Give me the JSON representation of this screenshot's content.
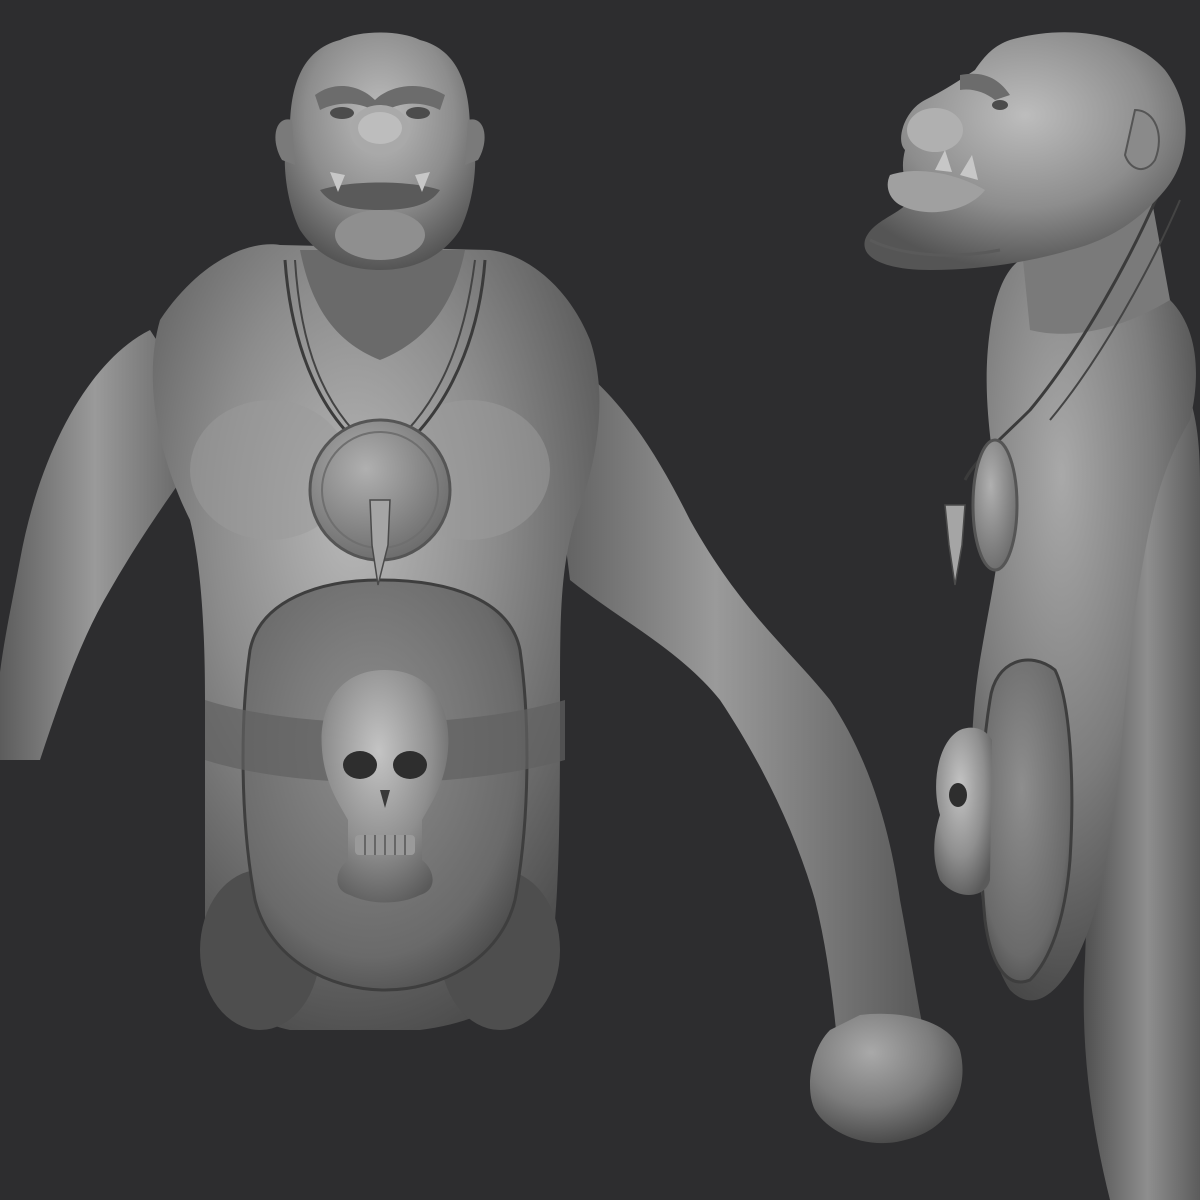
{
  "scene": {
    "background_color": "#2d2d2f",
    "material_light": "#b3b3b3",
    "material_mid": "#8a8a8a",
    "material_dark": "#4a4a4a",
    "views": [
      {
        "id": "front",
        "description_name": "orc-sculpt-front-view"
      },
      {
        "id": "side",
        "description_name": "orc-sculpt-side-view"
      }
    ]
  }
}
